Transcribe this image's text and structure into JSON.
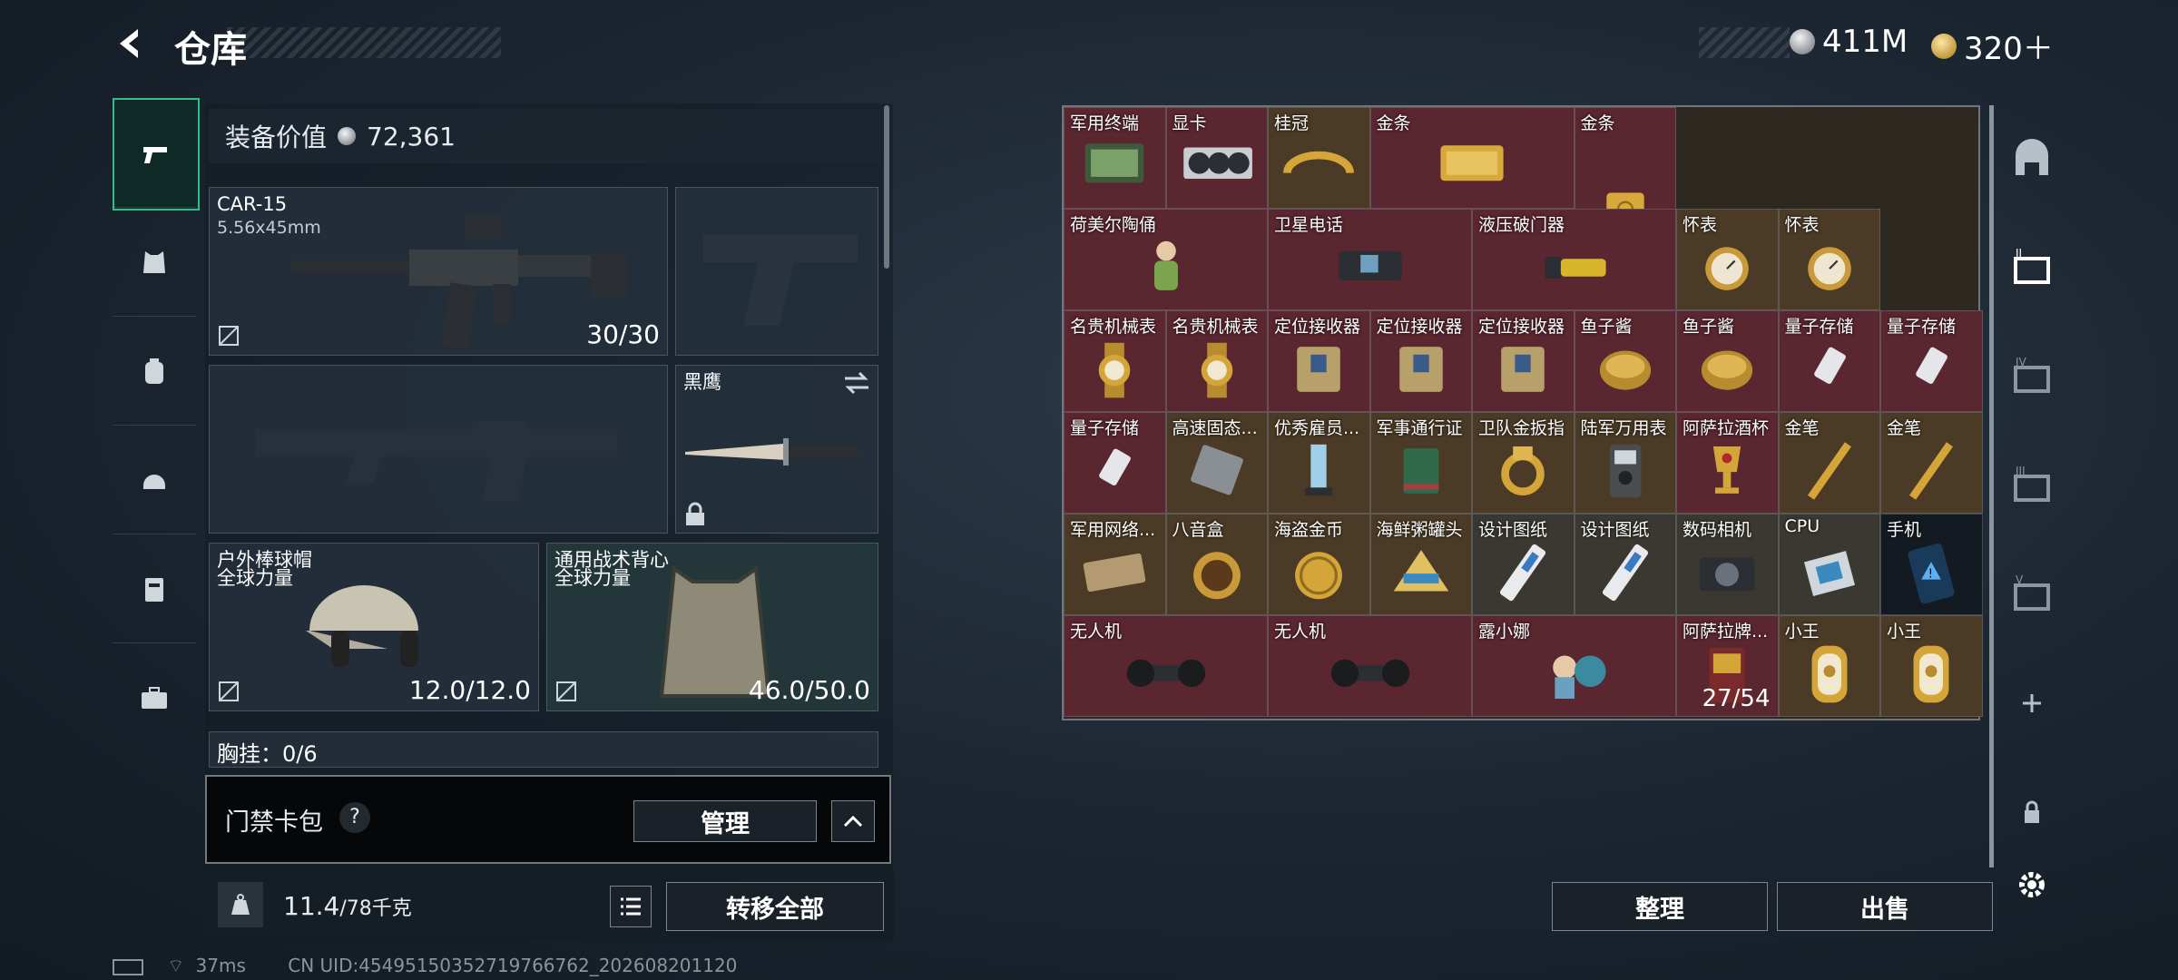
{
  "header": {
    "title": "仓库"
  },
  "currency": [
    {
      "icon": "silver-coin-icon",
      "value": "411M"
    },
    {
      "icon": "gold-coin-icon",
      "value": "320＋"
    }
  ],
  "left_nav": [
    {
      "name": "weapons-tab",
      "icon": "pistol-icon",
      "active": true
    },
    {
      "name": "armor-tab",
      "icon": "vest-icon"
    },
    {
      "name": "backpack-tab",
      "icon": "backpack-icon"
    },
    {
      "name": "helmet-tab",
      "icon": "helmet-icon"
    },
    {
      "name": "chest-rig-tab",
      "icon": "rig-icon"
    },
    {
      "name": "case-tab",
      "icon": "case-icon"
    }
  ],
  "loadout": {
    "value_label": "装备价值",
    "value": "72,361",
    "primary": {
      "name": "CAR-15",
      "ammo": "5.56x45mm",
      "count": "30/30"
    },
    "melee": {
      "name": "黑鹰"
    },
    "helmet": {
      "name": "户外棒球帽",
      "sub": "全球力量",
      "count": "12.0/12.0"
    },
    "armor": {
      "name": "通用战术背心",
      "sub": "全球力量",
      "count": "46.0/50.0"
    },
    "chest_partial": "胸挂：0/6",
    "chest_help": "?"
  },
  "card_pack": {
    "label": "门禁卡包",
    "help": "?",
    "manage": "管理"
  },
  "weight": {
    "value": "11.4",
    "max": "/78千克",
    "transfer_all": "转移全部"
  },
  "storage": {
    "items": [
      {
        "name": "军用终端",
        "c": 0,
        "r": 0,
        "w": 1,
        "h": 1,
        "bg": "#5a2630",
        "icon": "terminal"
      },
      {
        "name": "显卡",
        "c": 1,
        "r": 0,
        "w": 1,
        "h": 1,
        "bg": "#5a2630",
        "icon": "gpu"
      },
      {
        "name": "桂冠",
        "c": 2,
        "r": 0,
        "w": 1,
        "h": 1,
        "bg": "#4a3a26",
        "icon": "laurel"
      },
      {
        "name": "金条",
        "c": 3,
        "r": 0,
        "w": 2,
        "h": 1,
        "bg": "#5a2630",
        "icon": "goldbar"
      },
      {
        "name": "金条",
        "c": 5,
        "r": 0,
        "w": 1,
        "h": 2,
        "bg": "#5a2630",
        "icon": "goldbar-v"
      },
      {
        "name": "荷美尔陶俑",
        "c": 0,
        "r": 1,
        "w": 2,
        "h": 1,
        "bg": "#5a2630",
        "icon": "figurine"
      },
      {
        "name": "卫星电话",
        "c": 2,
        "r": 1,
        "w": 2,
        "h": 1,
        "bg": "#5a2630",
        "icon": "phone"
      },
      {
        "name": "液压破门器",
        "c": 4,
        "r": 1,
        "w": 2,
        "h": 1,
        "bg": "#5a2630",
        "icon": "breacher"
      },
      {
        "name": "怀表",
        "c": 6,
        "r": 1,
        "w": 1,
        "h": 1,
        "bg": "#4a3a26",
        "icon": "watch"
      },
      {
        "name": "怀表",
        "c": 7,
        "r": 1,
        "w": 1,
        "h": 1,
        "bg": "#4a3a26",
        "icon": "watch"
      },
      {
        "name": "名贵机械表",
        "c": 0,
        "r": 2,
        "w": 1,
        "h": 1,
        "bg": "#5a2630",
        "icon": "wristwatch"
      },
      {
        "name": "名贵机械表",
        "c": 1,
        "r": 2,
        "w": 1,
        "h": 1,
        "bg": "#5a2630",
        "icon": "wristwatch"
      },
      {
        "name": "定位接收器",
        "c": 2,
        "r": 2,
        "w": 1,
        "h": 1,
        "bg": "#5a2630",
        "icon": "receiver"
      },
      {
        "name": "定位接收器",
        "c": 3,
        "r": 2,
        "w": 1,
        "h": 1,
        "bg": "#5a2630",
        "icon": "receiver"
      },
      {
        "name": "定位接收器",
        "c": 4,
        "r": 2,
        "w": 1,
        "h": 1,
        "bg": "#5a2630",
        "icon": "receiver"
      },
      {
        "name": "鱼子酱",
        "c": 5,
        "r": 2,
        "w": 1,
        "h": 1,
        "bg": "#5a2630",
        "icon": "caviar"
      },
      {
        "name": "鱼子酱",
        "c": 6,
        "r": 2,
        "w": 1,
        "h": 1,
        "bg": "#5a2630",
        "icon": "caviar"
      },
      {
        "name": "量子存储",
        "c": 7,
        "r": 2,
        "w": 1,
        "h": 1,
        "bg": "#5a2630",
        "icon": "usb"
      },
      {
        "name": "量子存储",
        "c": 8,
        "r": 2,
        "w": 1,
        "h": 1,
        "bg": "#5a2630",
        "icon": "usb"
      },
      {
        "name": "量子存储",
        "c": 0,
        "r": 3,
        "w": 1,
        "h": 1,
        "bg": "#5a2630",
        "icon": "usb"
      },
      {
        "name": "高速固态...",
        "c": 1,
        "r": 3,
        "w": 1,
        "h": 1,
        "bg": "#4a3a26",
        "icon": "ssd"
      },
      {
        "name": "优秀雇员...",
        "c": 2,
        "r": 3,
        "w": 1,
        "h": 1,
        "bg": "#4a3a26",
        "icon": "trophy"
      },
      {
        "name": "军事通行证",
        "c": 3,
        "r": 3,
        "w": 1,
        "h": 1,
        "bg": "#4a3a26",
        "icon": "passbook"
      },
      {
        "name": "卫队金扳指",
        "c": 4,
        "r": 3,
        "w": 1,
        "h": 1,
        "bg": "#4a3a26",
        "icon": "ring"
      },
      {
        "name": "陆军万用表",
        "c": 5,
        "r": 3,
        "w": 1,
        "h": 1,
        "bg": "#4a3a26",
        "icon": "multimeter"
      },
      {
        "name": "阿萨拉酒杯",
        "c": 6,
        "r": 3,
        "w": 1,
        "h": 1,
        "bg": "#5a2630",
        "icon": "goblet"
      },
      {
        "name": "金笔",
        "c": 7,
        "r": 3,
        "w": 1,
        "h": 1,
        "bg": "#4a3a26",
        "icon": "pen"
      },
      {
        "name": "金笔",
        "c": 8,
        "r": 3,
        "w": 1,
        "h": 1,
        "bg": "#4a3a26",
        "icon": "pen"
      },
      {
        "name": "军用网络...",
        "c": 0,
        "r": 4,
        "w": 1,
        "h": 1,
        "bg": "#4a3a26",
        "icon": "router"
      },
      {
        "name": "八音盒",
        "c": 1,
        "r": 4,
        "w": 1,
        "h": 1,
        "bg": "#4a3a26",
        "icon": "musicbox"
      },
      {
        "name": "海盗金币",
        "c": 2,
        "r": 4,
        "w": 1,
        "h": 1,
        "bg": "#4a3a26",
        "icon": "coin"
      },
      {
        "name": "海鲜粥罐头",
        "c": 3,
        "r": 4,
        "w": 1,
        "h": 1,
        "bg": "#4a3a26",
        "icon": "can"
      },
      {
        "name": "设计图纸",
        "c": 4,
        "r": 4,
        "w": 1,
        "h": 1,
        "bg": "#3a3830",
        "icon": "blueprint"
      },
      {
        "name": "设计图纸",
        "c": 5,
        "r": 4,
        "w": 1,
        "h": 1,
        "bg": "#3a3830",
        "icon": "blueprint"
      },
      {
        "name": "数码相机",
        "c": 6,
        "r": 4,
        "w": 1,
        "h": 1,
        "bg": "#3a3830",
        "icon": "camera"
      },
      {
        "name": "CPU",
        "c": 7,
        "r": 4,
        "w": 1,
        "h": 1,
        "bg": "#3a3830",
        "icon": "cpu"
      },
      {
        "name": "手机",
        "c": 8,
        "r": 4,
        "w": 1,
        "h": 1,
        "bg": "#141a22",
        "icon": "mobile"
      },
      {
        "name": "无人机",
        "c": 0,
        "r": 5,
        "w": 2,
        "h": 1,
        "bg": "#5a2630",
        "icon": "drone"
      },
      {
        "name": "无人机",
        "c": 2,
        "r": 5,
        "w": 2,
        "h": 1,
        "bg": "#5a2630",
        "icon": "drone"
      },
      {
        "name": "露小娜",
        "c": 4,
        "r": 5,
        "w": 2,
        "h": 1,
        "bg": "#5a2630",
        "icon": "plush"
      },
      {
        "name": "阿萨拉牌...",
        "c": 6,
        "r": 5,
        "w": 1,
        "h": 1,
        "bg": "#5a2630",
        "icon": "cigs",
        "count": "27/54"
      },
      {
        "name": "小王",
        "c": 7,
        "r": 5,
        "w": 1,
        "h": 1,
        "bg": "#4a3a26",
        "icon": "plaque"
      },
      {
        "name": "小王",
        "c": 8,
        "r": 5,
        "w": 1,
        "h": 1,
        "bg": "#4a3a26",
        "icon": "plaque"
      }
    ]
  },
  "actions": {
    "sort": "整理",
    "sell": "出售"
  },
  "right_nav": [
    {
      "name": "storage-main-tab",
      "icon": "arch-icon"
    },
    {
      "name": "storage-tab-2",
      "icon": "storage-ii-icon"
    },
    {
      "name": "storage-tab-4",
      "icon": "storage-iv-icon"
    },
    {
      "name": "storage-tab-3",
      "icon": "storage-iii-icon"
    },
    {
      "name": "storage-tab-5",
      "icon": "storage-v-icon"
    },
    {
      "name": "add-storage",
      "icon": "plus-icon"
    },
    {
      "name": "lock-storage",
      "icon": "lock-icon"
    },
    {
      "name": "settings",
      "icon": "gear-icon"
    }
  ],
  "status": {
    "ping": "37ms",
    "uid": "CN UID:4549515035271976676​2_202608201120"
  }
}
